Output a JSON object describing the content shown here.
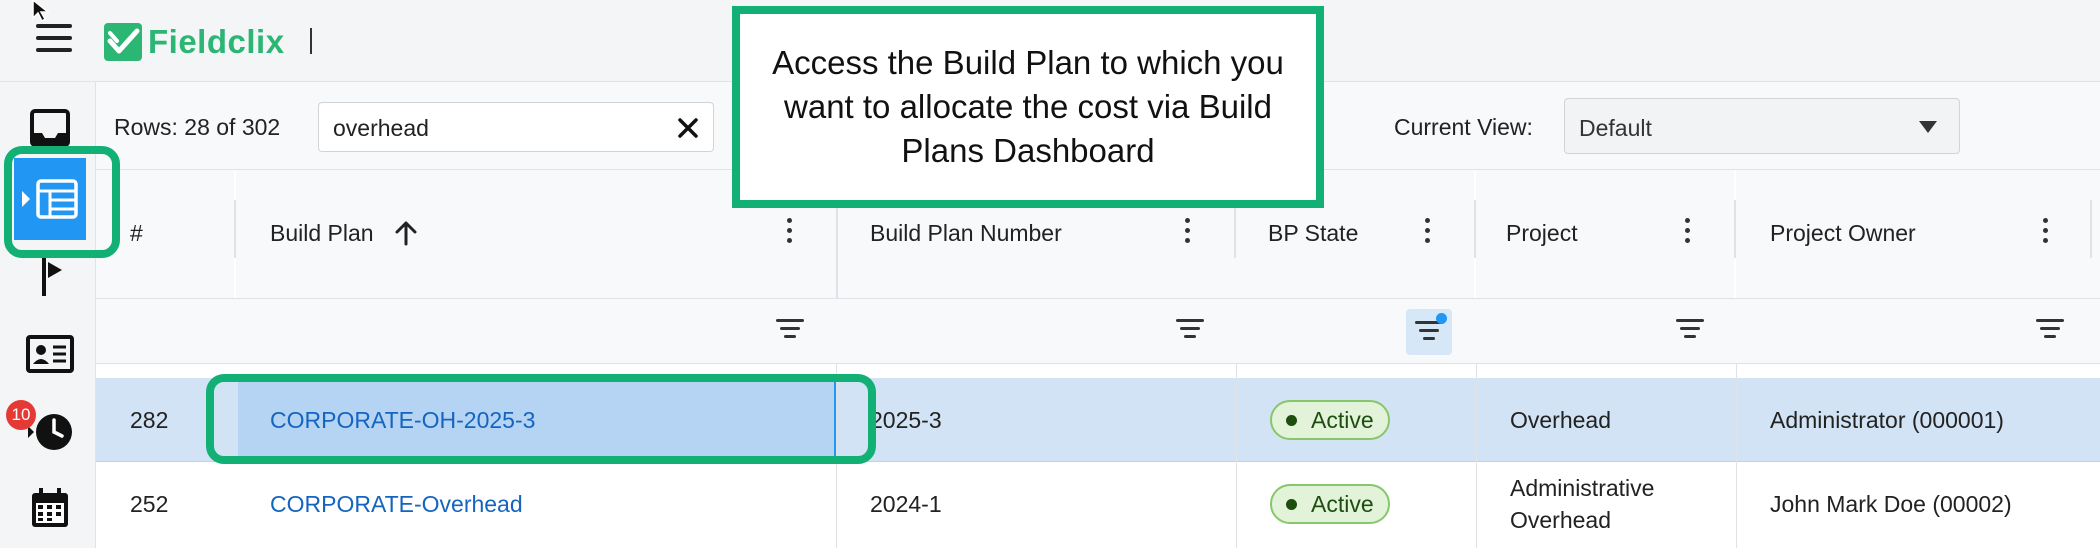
{
  "app": {
    "brand": "Fieldclix",
    "brand_color": "#2bb673",
    "accent_color": "#13b075"
  },
  "sidebar": {
    "items": [
      {
        "icon": "inbox-icon"
      },
      {
        "icon": "build-plans-dashboard-icon",
        "active": true
      },
      {
        "icon": "flag-icon"
      },
      {
        "icon": "id-card-icon"
      },
      {
        "icon": "timesheet-clock-icon",
        "badge": "10"
      },
      {
        "icon": "calendar-icon"
      }
    ]
  },
  "toolbar": {
    "rows_label": "Rows: 28 of 302",
    "search_value": "overhead",
    "current_view_label": "Current View:",
    "current_view_value": "Default"
  },
  "callout": {
    "text": "Access the Build Plan to which you want to allocate the cost via Build Plans Dashboard"
  },
  "grid": {
    "columns": [
      {
        "key": "num",
        "label": "#"
      },
      {
        "key": "build_plan",
        "label": "Build Plan",
        "sort": "ascending"
      },
      {
        "key": "build_plan_number",
        "label": "Build Plan Number"
      },
      {
        "key": "bp_state",
        "label": "BP State",
        "filter_active": true
      },
      {
        "key": "project",
        "label": "Project"
      },
      {
        "key": "project_owner",
        "label": "Project Owner"
      }
    ],
    "rows": [
      {
        "num": "282",
        "build_plan": "CORPORATE-OH-2025-3",
        "build_plan_number": "2025-3",
        "bp_state": "Active",
        "project": "Overhead",
        "project_owner": "Administrator (000001)",
        "selected": true
      },
      {
        "num": "252",
        "build_plan": "CORPORATE-Overhead",
        "build_plan_number": "2024-1",
        "bp_state": "Active",
        "project_line1": "Administrative",
        "project_line2": "Overhead",
        "project_owner": "John Mark Doe (00002)"
      }
    ]
  }
}
